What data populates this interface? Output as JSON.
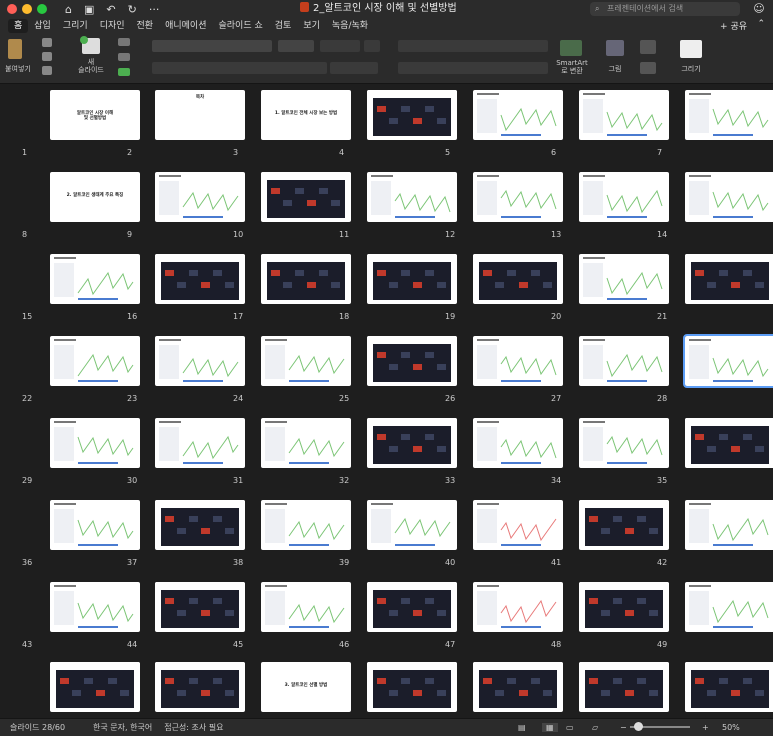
{
  "window": {
    "title": "2_알트코인 시장 이해 및 선별방법",
    "search_placeholder": "프레젠테이션에서 검색",
    "share_label": "공유"
  },
  "ribbon_tabs": [
    "홈",
    "삽입",
    "그리기",
    "디자인",
    "전환",
    "애니메이션",
    "슬라이드 쇼",
    "검토",
    "보기",
    "녹음/녹화"
  ],
  "ribbon": {
    "paste": "붙여넣기",
    "new_slide": "새\n슬라이드",
    "smartart": "SmartArt\n로 변환",
    "picture": "그림",
    "draw": "그리기"
  },
  "slides_total": 49,
  "title_slides": {
    "1": "알트코인 시장 이해\n및 선별방법",
    "2": "목차",
    "3": "1. 알트코인 전체 시장 보는 방법",
    "8": "2. 알트코인 생태계 주요 특징",
    "52": "3. 알트코인 선별 방법"
  },
  "status": {
    "slide": "슬라이드 28/60",
    "lang": "한국 문자, 한국어",
    "access": "접근성: 조사 필요",
    "zoom": "50%"
  },
  "colors": {
    "bg": "#1e1e1e",
    "chrome": "#2b2b2b",
    "accent": "#5c9df5",
    "chart_green": "#7cc576",
    "chart_red": "#e87a7a"
  }
}
